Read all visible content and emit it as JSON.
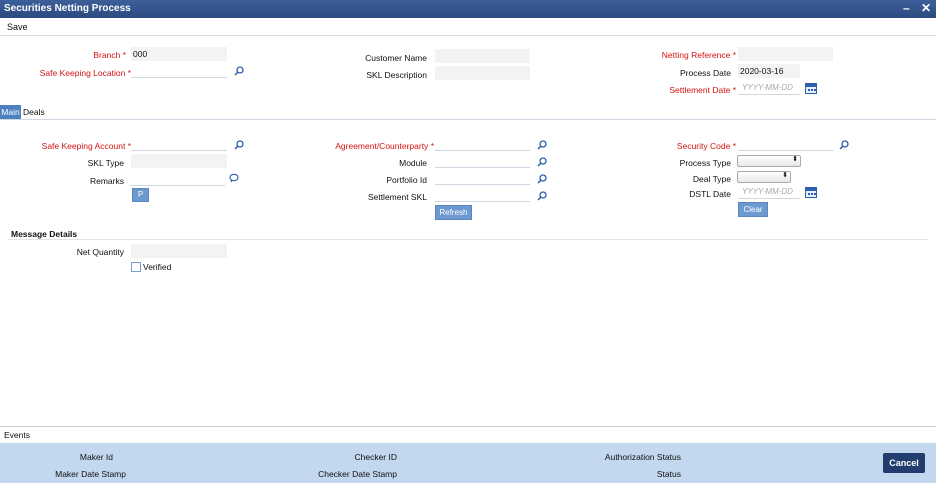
{
  "window": {
    "title": "Securities Netting Process",
    "minimize": "–",
    "close": "✕"
  },
  "toolbar": {
    "save_label": "Save"
  },
  "header": {
    "branch_label": "Branch",
    "branch_value": "000",
    "skl_label": "Safe Keeping Location",
    "customer_name_label": "Customer Name",
    "skl_description_label": "SKL Description",
    "netting_ref_label": "Netting Reference",
    "process_date_label": "Process Date",
    "process_date_value": "2020-03-16",
    "settlement_date_label": "Settlement Date",
    "settlement_date_placeholder": "YYYY-MM-DD",
    "required_marker": "*"
  },
  "tabs": [
    {
      "label": "Main"
    },
    {
      "label": "Deals"
    }
  ],
  "main": {
    "ska_label": "Safe Keeping Account",
    "skl_type_label": "SKL Type",
    "remarks_label": "Remarks",
    "p_button": "P",
    "agreement_label": "Agreement/Counterparty",
    "module_label": "Module",
    "portfolio_label": "Portfolio Id",
    "settlement_skl_label": "Settlement SKL",
    "refresh_button": "Refresh",
    "security_code_label": "Security Code",
    "process_type_label": "Process Type",
    "deal_type_label": "Deal Type",
    "dstl_date_label": "DSTL Date",
    "dstl_date_placeholder": "YYYY-MM-DD",
    "clear_button": "Clear"
  },
  "message_details": {
    "title": "Message Details",
    "net_quantity_label": "Net Quantity",
    "verified_label": "Verified"
  },
  "footer": {
    "events_label": "Events",
    "maker_id": "Maker Id",
    "maker_date_stamp": "Maker Date Stamp",
    "checker_id": "Checker ID",
    "checker_date_stamp": "Checker Date Stamp",
    "authorization_status": "Authorization Status",
    "status": "Status",
    "cancel_button": "Cancel"
  },
  "colors": {
    "title_bar": "#2c4a7f",
    "required": "#d21313",
    "accent": "#4e7fc0",
    "footer": "#c3d7ef",
    "cancel": "#233e6e"
  }
}
